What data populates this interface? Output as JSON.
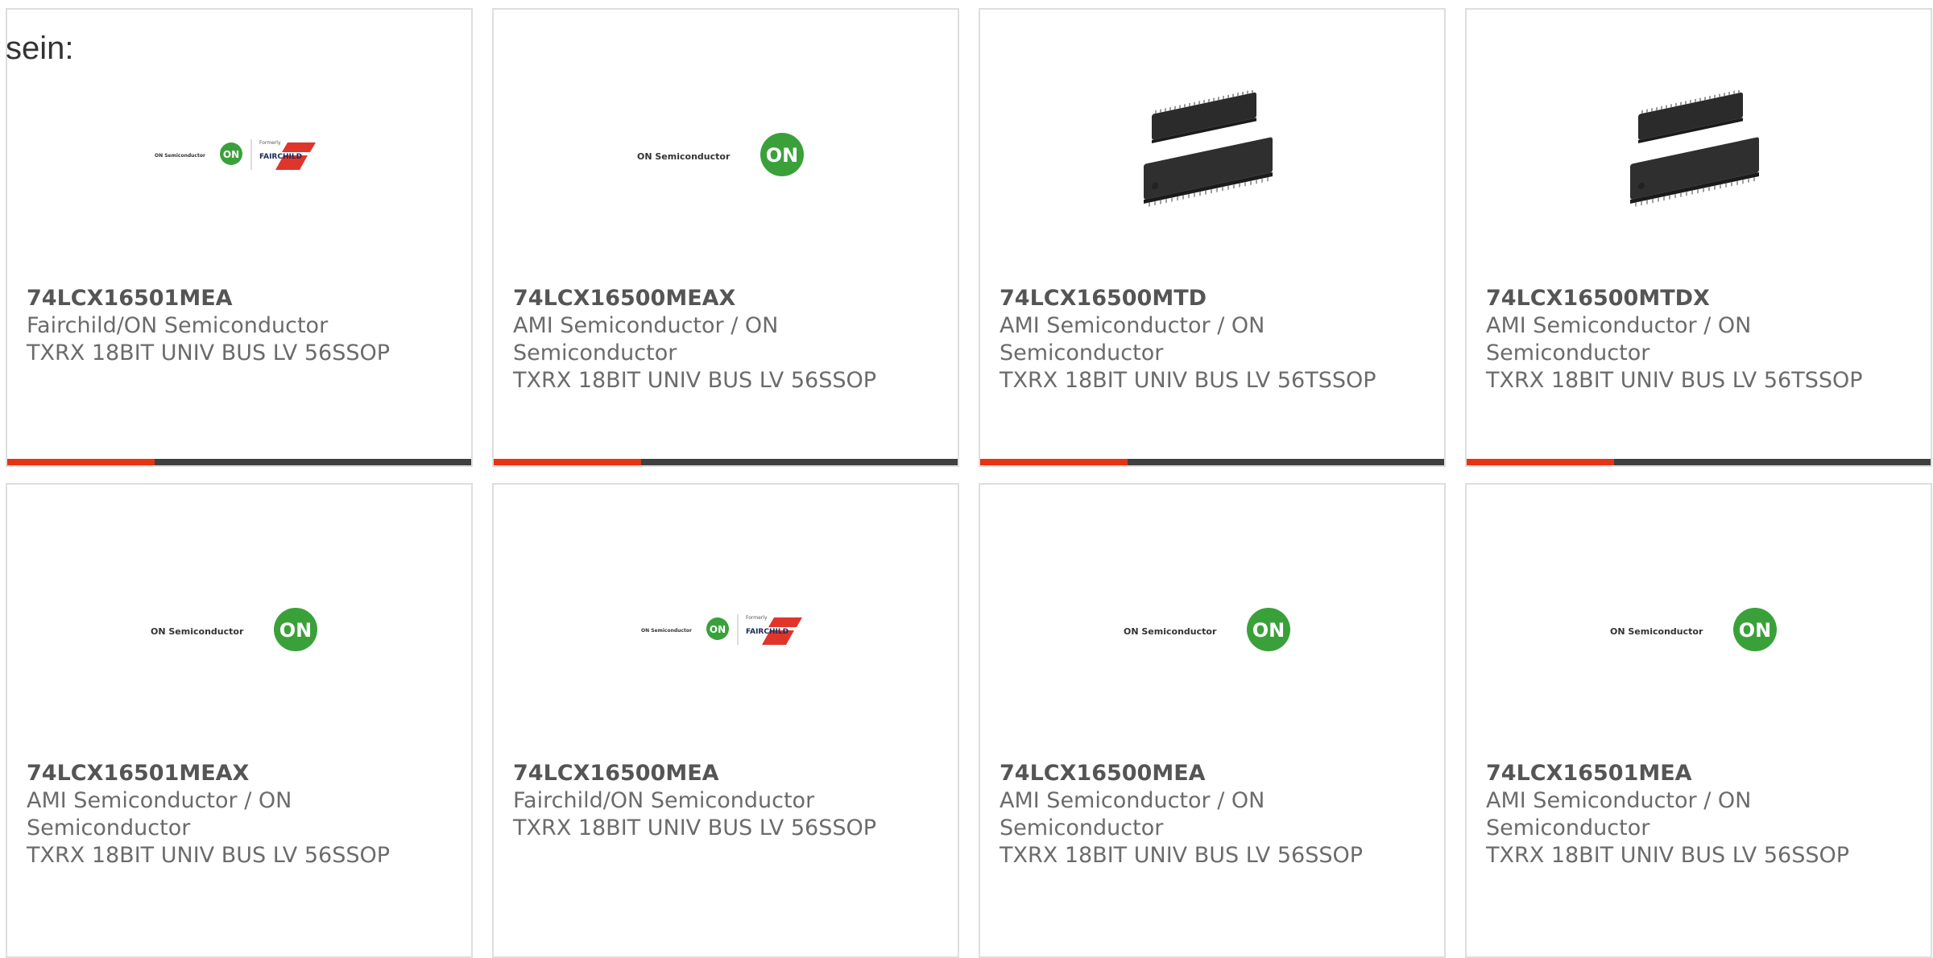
{
  "intro": "sein:",
  "colors": {
    "accent": "#e63312",
    "bar": "#3f3f3f",
    "on_green": "#3aa13a",
    "fairchild_red": "#e0352b"
  },
  "cards": [
    {
      "part": "74LCX16501MEA",
      "maker": "Fairchild/ON Semiconductor",
      "desc": "TXRX 18BIT UNIV BUS LV 56SSOP",
      "image": "onsemi-fairchild-logo",
      "row": 1
    },
    {
      "part": "74LCX16500MEAX",
      "maker": "AMI Semiconductor / ON Semiconductor",
      "desc": "TXRX 18BIT UNIV BUS LV 56SSOP",
      "image": "onsemi-logo",
      "row": 1
    },
    {
      "part": "74LCX16500MTD",
      "maker": "AMI Semiconductor / ON Semiconductor",
      "desc": "TXRX 18BIT UNIV BUS LV 56TSSOP",
      "image": "chip-photo",
      "row": 1
    },
    {
      "part": "74LCX16500MTDX",
      "maker": "AMI Semiconductor / ON Semiconductor",
      "desc": "TXRX 18BIT UNIV BUS LV 56TSSOP",
      "image": "chip-photo",
      "row": 1
    },
    {
      "part": "74LCX16501MEAX",
      "maker": "AMI Semiconductor / ON Semiconductor",
      "desc": "TXRX 18BIT UNIV BUS LV 56SSOP",
      "image": "onsemi-logo",
      "row": 2
    },
    {
      "part": "74LCX16500MEA",
      "maker": "Fairchild/ON Semiconductor",
      "desc": "TXRX 18BIT UNIV BUS LV 56SSOP",
      "image": "onsemi-fairchild-logo",
      "row": 2
    },
    {
      "part": "74LCX16500MEA",
      "maker": "AMI Semiconductor / ON Semiconductor",
      "desc": "TXRX 18BIT UNIV BUS LV 56SSOP",
      "image": "onsemi-logo",
      "row": 2
    },
    {
      "part": "74LCX16501MEA",
      "maker": "AMI Semiconductor / ON Semiconductor",
      "desc": "TXRX 18BIT UNIV BUS LV 56SSOP",
      "image": "onsemi-logo",
      "row": 2
    }
  ],
  "logo_text": {
    "on_semi": "ON Semiconductor",
    "on": "ON",
    "formerly": "Formerly",
    "fairchild": "FAIRCHILD"
  }
}
